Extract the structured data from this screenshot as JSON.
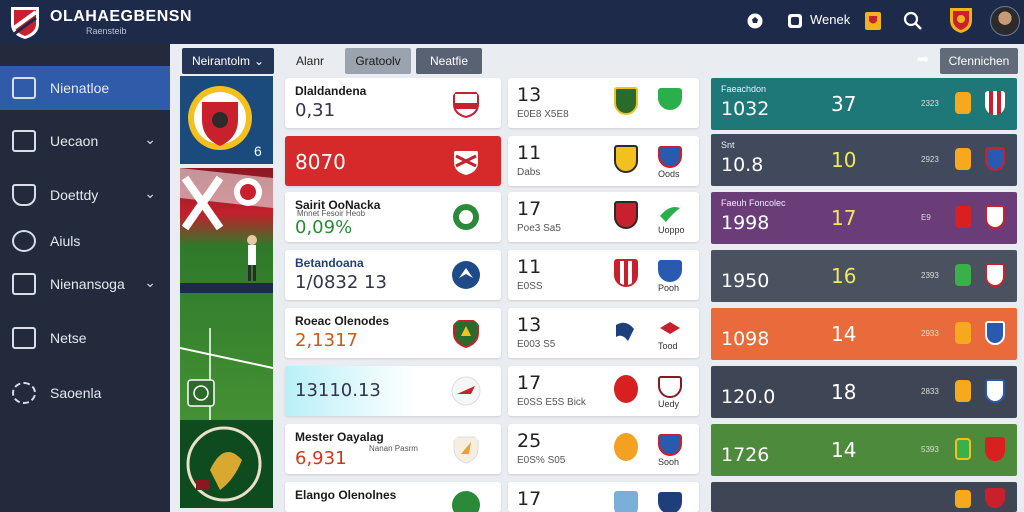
{
  "header": {
    "title": "OLAHAEGBENSN",
    "subtitle": "Raensteib",
    "user_label": "Wenek",
    "icons": [
      "soccer-ball-icon",
      "team-badge-icon",
      "trophy-badge-icon",
      "search-icon",
      "club-crest-icon"
    ],
    "colors": {
      "bar": "#1e2a4a"
    }
  },
  "sidebar": {
    "items": [
      {
        "label": "Nienatloe",
        "icon": "document-icon",
        "active": true,
        "chevron": false
      },
      {
        "label": "Uecaon",
        "icon": "window-icon",
        "active": false,
        "chevron": true
      },
      {
        "label": "Doettdy",
        "icon": "shield-icon",
        "active": false,
        "chevron": true
      },
      {
        "label": "Aiuls",
        "icon": "ball-icon",
        "active": false,
        "chevron": false
      },
      {
        "label": "Nienansoga",
        "icon": "network-icon",
        "active": false,
        "chevron": true
      },
      {
        "label": "Netse",
        "icon": "folder-icon",
        "active": false,
        "chevron": false
      },
      {
        "label": "Saoenla",
        "icon": "gear-icon",
        "active": false,
        "chevron": false
      }
    ]
  },
  "toolbar": {
    "dropdown": "Neirantolm",
    "tabs": [
      "Alanr",
      "Gratoolv",
      "Neatfie"
    ],
    "right_button": "Cfennichen"
  },
  "cards": [
    {
      "title": "Dlaldandena",
      "value": "0,31",
      "count": "13",
      "count_sub": "E0E8 X5E8",
      "b_label": "",
      "style": "white"
    },
    {
      "title": "",
      "value": "8070",
      "count": "11",
      "count_sub": "Dabs",
      "b_label": "Oods",
      "style": "red"
    },
    {
      "title": "Sairit OoNacka",
      "sub": "Mnnet Fesoir Heob",
      "value": "0,09%",
      "count": "17",
      "count_sub": "Poe3 Sa5",
      "b_label": "Uoppo",
      "style": "white"
    },
    {
      "title": "Betandoana",
      "value": "1/0832 13",
      "count": "11",
      "count_sub": "E0SS",
      "b_label": "Pooh",
      "style": "white"
    },
    {
      "title": "Roeac Olenodes",
      "value": "2,1317",
      "count": "13",
      "count_sub": "E003 S5",
      "b_label": "Tood",
      "style": "white"
    },
    {
      "title": "",
      "value": "13110.13",
      "count": "17",
      "count_sub": "E0SS E5S Bick",
      "b_label": "Uedy",
      "style": "lightblue"
    },
    {
      "title": "Mester Oayalag",
      "sub": "Nanan Pasrm",
      "value": "6,931",
      "count": "25",
      "count_sub": "E0S% S05",
      "b_label": "Sooh",
      "style": "white"
    },
    {
      "title": "Elango Olenolnes",
      "value": "",
      "count": "17",
      "count_sub": "",
      "b_label": "",
      "style": "white"
    }
  ],
  "stats": [
    {
      "label": "Faeachdon",
      "big": "1032",
      "mid": "37",
      "sm": "2323",
      "color": "#1f7878"
    },
    {
      "label": "Snt",
      "big": "10.8",
      "mid": "10",
      "sm": "2923",
      "color": "#404a5c"
    },
    {
      "label": "Faeuh Foncolec",
      "big": "1998",
      "mid": "17",
      "sm": "E9",
      "color": "#6a3d78"
    },
    {
      "label": "",
      "big": "1950",
      "mid": "16",
      "sm": "2393",
      "color": "#4a5260"
    },
    {
      "label": "",
      "big": "1098",
      "mid": "14",
      "sm": "2933",
      "color": "#e96a3a"
    },
    {
      "label": "",
      "big": "120.0",
      "mid": "18",
      "sm": "2833",
      "color": "#3e4656"
    },
    {
      "label": "",
      "big": "1726",
      "mid": "14",
      "sm": "5393",
      "color": "#4e8a3c"
    },
    {
      "label": "",
      "big": "",
      "mid": "",
      "sm": "",
      "color": "#3e4656"
    }
  ]
}
